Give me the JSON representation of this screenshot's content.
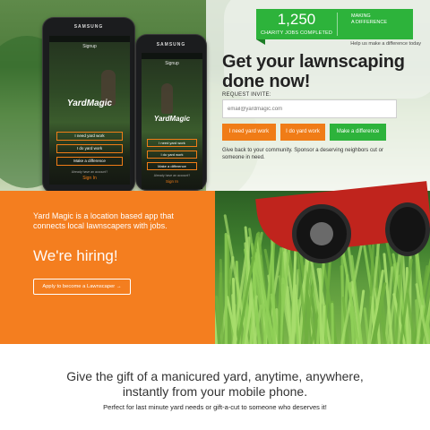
{
  "phones": {
    "carrier": "SAMSUNG",
    "screen_title": "Signup",
    "app_logo": "YardMagic",
    "buttons": [
      "I need yard work",
      "I do yard work",
      "Make a difference"
    ],
    "already_label": "Already have an account?",
    "sign_in": "Sign In"
  },
  "stats": {
    "count": "1,250",
    "count_label": "CHARITY JOBS COMPLETED",
    "tagline_line1": "MAKING",
    "tagline_line2": "A DIFFERENCE",
    "help_text": "Help us make a difference today"
  },
  "hero": {
    "headline_line1": "Get your lawnscaping",
    "headline_line2": "done now!",
    "request_label": "REQUEST INVITE:",
    "email_placeholder": "email@yardmagic.com",
    "buttons": {
      "need": "I need yard work",
      "do": "I do yard work",
      "difference": "Make a difference"
    },
    "give_back": "Give back to your community. Sponsor a deserving neighbors cut or someone in need."
  },
  "hiring": {
    "description": "Yard Magic is a location based app that connects local lawnscapers with jobs.",
    "title": "We're hiring!",
    "apply_label": "Apply to become a Lawnscaper →"
  },
  "footer": {
    "title_line1": "Give the gift of a manicured yard, anytime, anywhere,",
    "title_line2": "instantly from your mobile phone.",
    "subtitle": "Perfect for last minute yard needs or gift-a-cut to someone who deserves it!"
  },
  "colors": {
    "orange": "#f47e1f",
    "green": "#2db33b"
  }
}
